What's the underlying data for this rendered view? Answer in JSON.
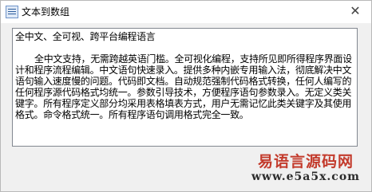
{
  "window": {
    "title": "文本到数组",
    "close_glyph": "✕",
    "app_icon": "app-window-icon"
  },
  "editor": {
    "heading": "全中文、全可视、跨平台编程语言",
    "body": "全中文支持，无需跨越英语门槛。全可视化编程，支持所见即所得程序界面设计和程序流程编辑。中文语句快速录入。提供多种内嵌专用输入法，彻底解决中文语句输入速度慢的问题。代码即文档。自动规范强制代码格式转换，任何人编写的任何程序源代码格式均统一。参数引导技术，方便程序语句参数录入。无定义类关键字。所有程序定义部分均采用表格填表方式，用户无需记忆此类关键字及其使用格式。命令格式统一。所有程序语句调用格式完全一致。"
  },
  "watermark": {
    "title": "易语言源码网",
    "url": "www.e5a5x.com",
    "title_color": "#c33b2c"
  }
}
